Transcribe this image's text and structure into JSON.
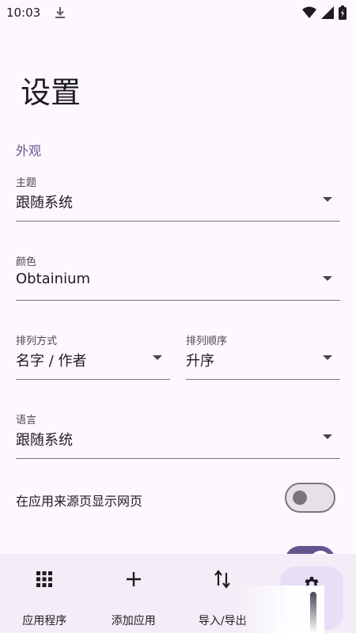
{
  "status_bar": {
    "time": "10:03",
    "icons": [
      "download-icon",
      "wifi-icon",
      "signal-icon",
      "battery-icon"
    ]
  },
  "page": {
    "title": "设置"
  },
  "appearance": {
    "section_title": "外观",
    "theme": {
      "label": "主题",
      "value": "跟随系统"
    },
    "color": {
      "label": "颜色",
      "value": "Obtainium"
    },
    "sort_by": {
      "label": "排列方式",
      "value": "名字 / 作者"
    },
    "sort_order": {
      "label": "排列顺序",
      "value": "升序"
    },
    "language": {
      "label": "语言",
      "value": "跟随系统"
    },
    "show_webpage": {
      "label": "在应用来源页显示网页",
      "enabled": false
    }
  },
  "nav": {
    "items": [
      {
        "label": "应用程序",
        "icon": "apps-grid-icon"
      },
      {
        "label": "添加应用",
        "icon": "add-icon"
      },
      {
        "label": "导入/导出",
        "icon": "import-export-icon"
      },
      {
        "label": "",
        "icon": "settings-gear-icon"
      }
    ],
    "active_index": 3
  },
  "colors": {
    "background": "#fef7ff",
    "accent": "#65558f",
    "nav_background": "#f3edf7",
    "active_indicator": "#e8def8"
  }
}
